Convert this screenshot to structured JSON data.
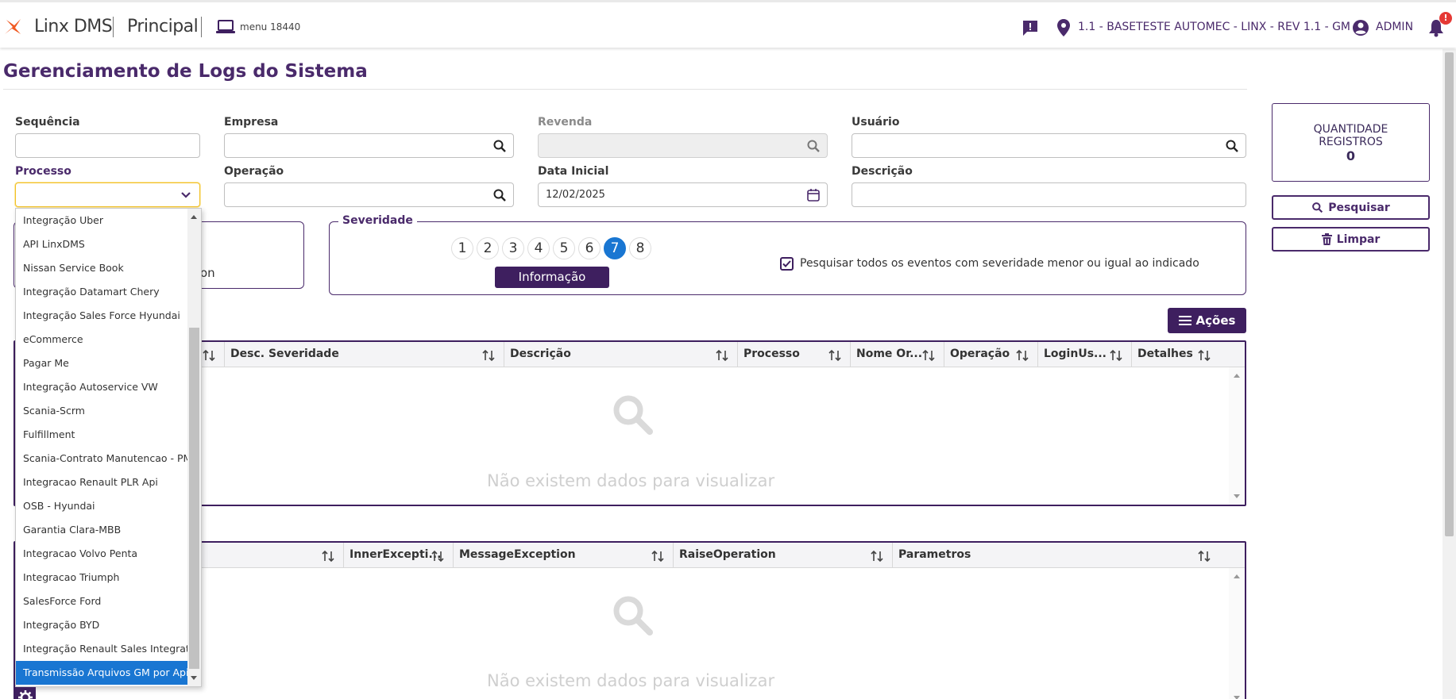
{
  "header": {
    "app_name": "Linx DMS",
    "module": "Principal",
    "menu_code": "menu 18440",
    "dealer": "1.1 - BASETESTE AUTOMEC - LINX - REV 1.1 - GM",
    "user": "ADMIN",
    "notification_count": "!",
    "brand_color": "#4a2a6b",
    "logo_color": "#f05a22"
  },
  "page": {
    "title": "Gerenciamento de Logs do Sistema"
  },
  "filters": {
    "sequencia": {
      "label": "Sequência",
      "value": ""
    },
    "empresa": {
      "label": "Empresa",
      "value": ""
    },
    "revenda": {
      "label": "Revenda",
      "value": ""
    },
    "usuario": {
      "label": "Usuário",
      "value": ""
    },
    "processo": {
      "label": "Processo",
      "value": ""
    },
    "operacao": {
      "label": "Operação",
      "value": ""
    },
    "data_inicial": {
      "label": "Data Inicial",
      "value": "12/02/2025"
    },
    "descricao": {
      "label": "Descrição",
      "value": ""
    }
  },
  "side": {
    "qty_label": "QUANTIDADE REGISTROS",
    "qty_value": "0",
    "search_label": "Pesquisar",
    "clear_label": "Limpar"
  },
  "left_fieldset": {
    "partial_text": "on"
  },
  "severity": {
    "legend": "Severidade",
    "levels": [
      "1",
      "2",
      "3",
      "4",
      "5",
      "6",
      "7",
      "8"
    ],
    "selected": "7",
    "selected_label": "Informação",
    "checkbox_label": "Pesquisar todos os eventos com severidade menor ou igual ao indicado",
    "checkbox_checked": true
  },
  "actions": {
    "label": "Ações"
  },
  "grid1": {
    "columns": [
      "Desc. Severidade",
      "Descrição",
      "Processo",
      "Nome Or...",
      "Operação",
      "LoginUs...",
      "Detalhes"
    ],
    "empty_text": "Não existem dados para visualizar"
  },
  "grid2": {
    "columns": [
      "InnerExcepti...",
      "MessageException",
      "RaiseOperation",
      "Parametros"
    ],
    "empty_text": "Não existem dados para visualizar"
  },
  "processo_dropdown": {
    "items": [
      "Integração Uber",
      "API LinxDMS",
      "Nissan Service Book",
      "Integração Datamart Chery",
      "Integração Sales Force Hyundai",
      "eCommerce",
      "Pagar Me",
      "Integração Autoservice VW",
      "Scania-Scrm",
      "Fulfillment",
      "Scania-Contrato Manutencao - PMS",
      "Integracao Renault PLR Api",
      "OSB - Hyundai",
      "Garantia Clara-MBB",
      "Integracao Volvo Penta",
      "Integracao Triumph",
      "SalesForce Ford",
      "Integração BYD",
      "Integração Renault Sales Integration",
      "Transmissão Arquivos GM por Api"
    ],
    "selected_index": 19
  }
}
